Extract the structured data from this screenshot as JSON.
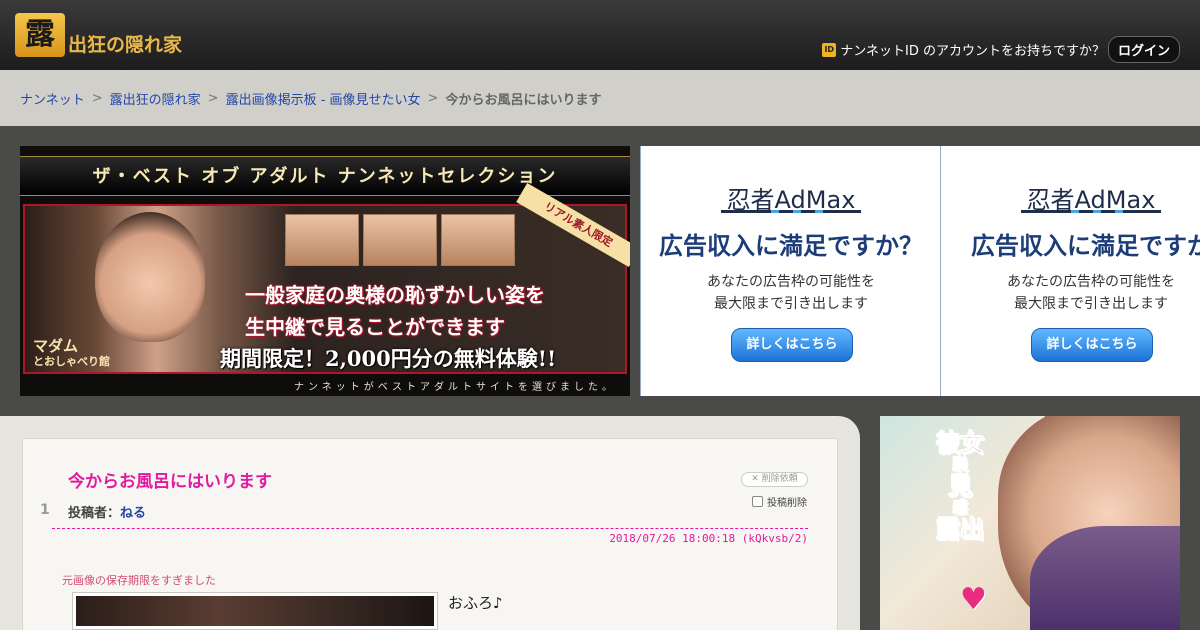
{
  "header": {
    "logo_mark": "露",
    "logo_text": "出狂の隠れ家",
    "id_badge": "ID",
    "account_prompt": "ナンネットID のアカウントをお持ちですか？",
    "login_label": "ログイン"
  },
  "breadcrumb": {
    "items": [
      "ナンネット",
      "露出狂の隠れ家",
      "露出画像掲示板 - 画像見せたい女"
    ],
    "separator": ">",
    "current": "今からお風呂にはいります"
  },
  "banner": {
    "title": "ザ・ベスト オブ アダルト ナンネットセレクション",
    "ribbon": "リアル素人限定",
    "line1": "一般家庭の奥様の恥ずかしい姿を",
    "line2": "生中継で見ることができます",
    "line3": "期間限定！2,000円分の無料体験!!",
    "madam_line1": "マダム",
    "madam_line2": "とおしゃべり館",
    "footer": "ナンネットがベストアダルトサイトを選びました。"
  },
  "ads": [
    {
      "brand": "忍者AdMax",
      "headline": "広告収入に満足ですか？",
      "sub1": "あなたの広告枠の可能性を",
      "sub2": "最大限まで引き出します",
      "button": "詳しくはこちら"
    },
    {
      "brand": "忍者AdMax",
      "headline": "広告収入に満足ですか",
      "sub1": "あなたの広告枠の可能性を",
      "sub2": "最大限まで引き出します",
      "button": "詳しくはこちら"
    }
  ],
  "post": {
    "number": "1",
    "title": "今からお風呂にはいります",
    "poster_label": "投稿者：",
    "poster_name": "ねる",
    "delete_request": "削除依頼",
    "delete_post": "投稿削除",
    "meta": "2018/07/26 18:00:18 (kQkvsb/2)",
    "image_expired": "元画像の保存期限をすぎました",
    "body": "おふろ♪"
  },
  "side_ad": {
    "text_lines": [
      "彼女",
      "脱",
      "見",
      "感",
      "露出"
    ]
  },
  "colors": {
    "accent_pink": "#e21aa2",
    "link_blue": "#2346a8",
    "header_bg": "#1c1c1c",
    "crumb_bg": "#d0cfca"
  }
}
